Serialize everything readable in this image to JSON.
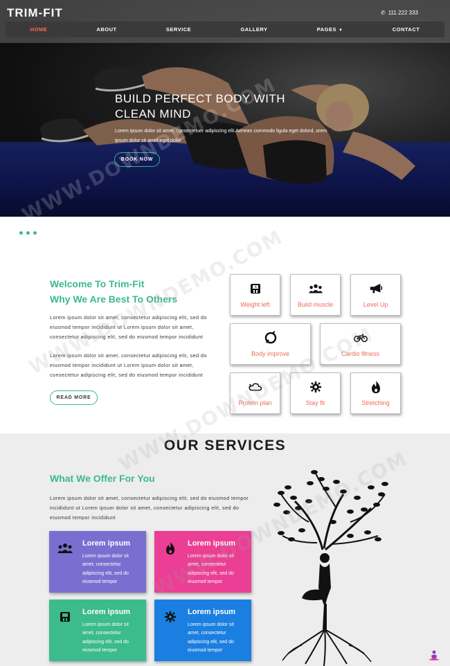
{
  "header": {
    "logo": "TRIM-FIT",
    "phone": "111 222 333",
    "phone_icon": "phone-icon"
  },
  "nav": {
    "items": [
      {
        "label": "HOME",
        "active": true
      },
      {
        "label": "ABOUT"
      },
      {
        "label": "SERVICE"
      },
      {
        "label": "GALLERY"
      },
      {
        "label": "PAGES"
      },
      {
        "label": "CONTACT"
      }
    ]
  },
  "hero": {
    "title": "BUILD PERFECT BODY WITH CLEAN MIND",
    "text": "Lorem ipsum dolor sit amet, consectetuer adipiscing elit.Aenean commodo ligula eget dolord, orem ipsum dolor sit amet eget dolor",
    "button": "BOOK NOW"
  },
  "welcome": {
    "title": "Welcome To Trim-Fit",
    "subtitle": "Why We Are Best To Others",
    "para1": "Lorem ipsum dolor sit amet, consectetur adipiscing elit, sed do eiusmod tempor incididunt ut Lorem ipsum dolor sit amet, consectetur adipiscing elit, sed do eiusmod tempor incididunt",
    "para2": "Lorem ipsum dolor sit amet, consectetur adipiscing elit, sed do eiusmod tempor incididunt ut Lorem ipsum dolor sit amet, consectetur adipiscing elit, sed do eiusmod tempor incididunt",
    "button": "READ MORE"
  },
  "features": [
    {
      "label": "Weight left",
      "icon": "scale-icon"
    },
    {
      "label": "Build muscle",
      "icon": "group-icon"
    },
    {
      "label": "Level Up",
      "icon": "megaphone-icon"
    },
    {
      "label": "Body improve",
      "icon": "body-icon"
    },
    {
      "label": "Cardio fitness",
      "icon": "bicycle-icon"
    },
    {
      "label": "Protein plan",
      "icon": "cloud-icon"
    },
    {
      "label": "Stay fit",
      "icon": "gear-icon"
    },
    {
      "label": "Stretching",
      "icon": "flame-icon"
    }
  ],
  "services": {
    "title": "OUR SERVICES",
    "offer_title": "What We Offer For You",
    "offer_text": "Lorem ipsum dolor sit amet, consectetur adipiscing elit, sed do eiusmod tempor incididunt ut Lorem ipsum dolor sit amet, consectetur adipiscing elit, sed do eiusmod tempor incididunt",
    "cards": [
      {
        "title": "Lorem ipsum",
        "text": "Lorem ipsum dolor sit amet, consectetur adipiscing elit, sed do eiusmod tempor",
        "color": "#7a6fd0",
        "icon": "group-icon"
      },
      {
        "title": "Lorem ipsum",
        "text": "Lorem ipsum dolor sit amet, consectetur adipiscing elit, sed do eiusmod tempor",
        "color": "#ea3f94",
        "icon": "flame-icon"
      },
      {
        "title": "Lorem ipsum",
        "text": "Lorem ipsum dolor sit amet, consectetur adipiscing elit, sed do eiusmod tempor",
        "color": "#3cbb8c",
        "icon": "scale-icon"
      },
      {
        "title": "Lorem ipsum",
        "text": "Lorem ipsum dolor sit amet, consectetur adipiscing elit, sed do eiusmod tempor",
        "color": "#1a7fe0",
        "icon": "gear-icon"
      }
    ]
  },
  "watermark": "WWW.DOWNDEMO.COM",
  "colors": {
    "accent": "#3cb98b",
    "feature_label": "#f06a5a",
    "nav_active": "#ff6a4a"
  }
}
